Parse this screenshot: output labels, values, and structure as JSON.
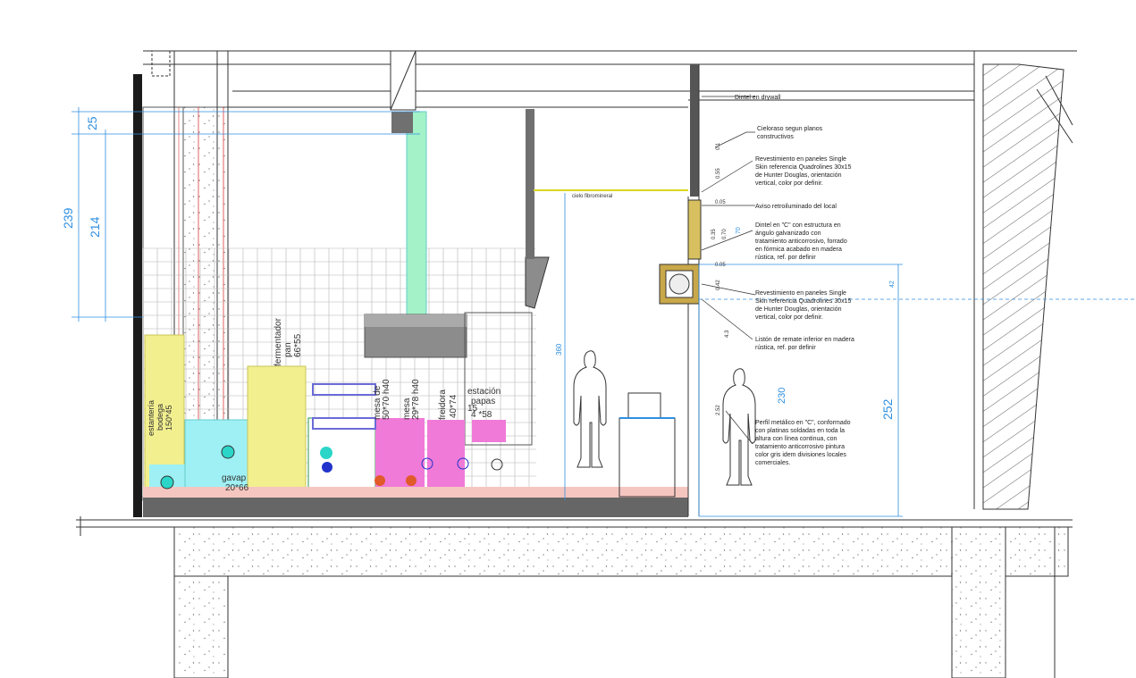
{
  "dimensions": {
    "d25": "25",
    "d239": "239",
    "d214": "214",
    "d360": "360",
    "d252": "252",
    "d230": "230",
    "d42": "42",
    "small": {
      "v001": "0.1",
      "v055": "0.55",
      "v005a": "0.05",
      "v035": "0.35",
      "v070": "0.70",
      "v70": "70",
      "v005b": "0.05",
      "v042": "0.42",
      "v43": "4.3",
      "v252b": "2.52"
    }
  },
  "notes": {
    "dintel_drywall": "Dintel en drywall",
    "cieloraso_1": "Cieloraso segun planos",
    "cieloraso_2": "constructivos",
    "rev1_1": "Revestimiento en paneles Single",
    "rev1_2": "Skin referencia Quadrolines 30x15",
    "rev1_3": "de Hunter Douglas, orientación",
    "rev1_4": "vertical, color por definir.",
    "aviso": "Aviso retroiluminado del local",
    "dintelc_1": "Dintel en \"C\" con estructura en",
    "dintelc_2": "ángulo galvanizado con",
    "dintelc_3": "tratamiento anticorrosivo, forrado",
    "dintelc_4": "en fórmica acabado en madera",
    "dintelc_5": "rústica, ref. por definir",
    "rev2_1": "Revestimiento en paneles Single",
    "rev2_2": "Skin referencia Quadrolines 30x15",
    "rev2_3": "de Hunter Douglas, orientación",
    "rev2_4": "vertical, color por definir.",
    "liston_1": "Listón de remate inferior en madera",
    "liston_2": "rústica, ref. por definir",
    "perfil_1": "Perfil metálico en \"C\", conformado",
    "perfil_2": "con platinas soldadas en toda la",
    "perfil_3": "altura con línea continua, con",
    "perfil_4": "tratamiento anticorrosivo pintura",
    "perfil_5": "color gris idem divisiones locales",
    "perfil_6": "comerciales.",
    "cielo_fibro": "cielo fibromineral"
  },
  "equipment": {
    "estanteria_1": "estantería",
    "estanteria_2": "bodega",
    "estanteria_3": "150*45",
    "fermentador_1": "fermentador",
    "fermentador_2": "pan",
    "fermentador_3": "66*55",
    "gavap_1": "gavap",
    "gavap_2": "20*66",
    "mesa1_1": "mesa de",
    "mesa1_2": "50*70 h40",
    "mesa2_1": "mesa",
    "mesa2_2": "29*78 h40",
    "freidora_1": "freidora",
    "freidora_2": "40*74",
    "estacion_1": "estación",
    "estacion_2": "papas",
    "estacion_3": "15",
    "estacion_4": "4 *58"
  },
  "colors": {
    "dim": "#2f8fe0",
    "yellow": "#f2ef8f",
    "cyan": "#9ff0f4",
    "pink": "#f07ad8",
    "mint": "#a4f2c8",
    "grey": "#8c8c8c"
  }
}
